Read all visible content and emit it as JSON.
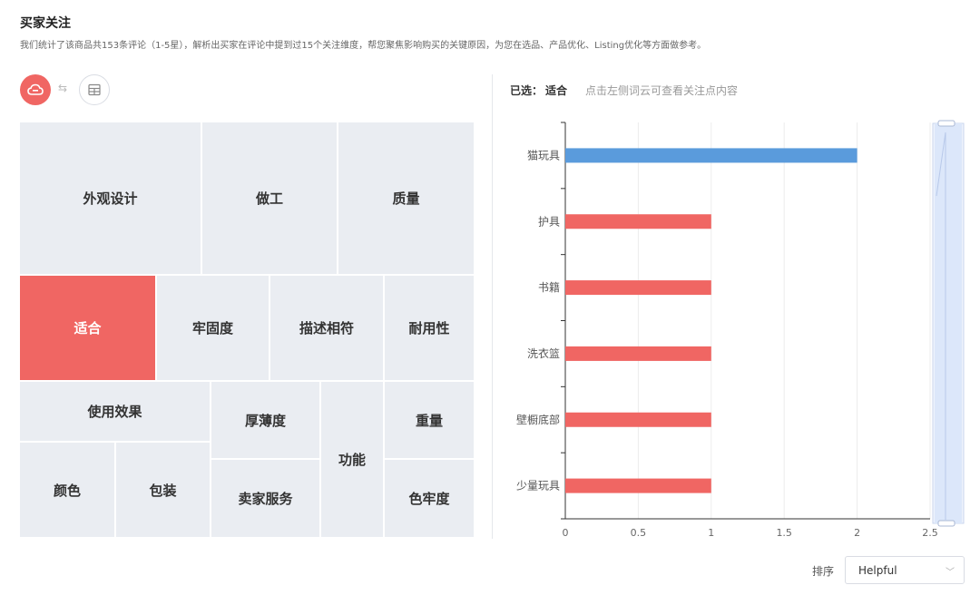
{
  "header": {
    "title": "买家关注",
    "description": "我们统计了该商品共153条评论（1-5星），解析出买家在评论中提到过15个关注维度，帮您聚焦影响购买的关键原因，为您在选品、产品优化、Listing优化等方面做参考。"
  },
  "view_toggle": {
    "active": "wordcloud",
    "icons": [
      "wordcloud-icon",
      "swap-icon",
      "table-icon"
    ],
    "swap_glyph": "⇆"
  },
  "treemap": {
    "selected": "适合",
    "tiles": [
      "外观设计",
      "做工",
      "质量",
      "适合",
      "牢固度",
      "描述相符",
      "耐用性",
      "使用效果",
      "厚薄度",
      "功能",
      "重量",
      "颜色",
      "包装",
      "卖家服务",
      "色牢度"
    ]
  },
  "detail": {
    "selected_label": "已选：",
    "selected_value": "适合",
    "hint": "点击左侧词云可查看关注点内容"
  },
  "chart_data": {
    "type": "bar",
    "orientation": "horizontal",
    "categories": [
      "猫玩具",
      "护具",
      "书籍",
      "洗衣篮",
      "壁橱底部",
      "少量玩具"
    ],
    "values": [
      2,
      1,
      1,
      1,
      1,
      1
    ],
    "highlighted": "猫玩具",
    "colors": {
      "highlight": "#5a9bdc",
      "default": "#f06663"
    },
    "xlim": [
      0,
      2.5
    ],
    "xticks": [
      "0",
      "0.5",
      "1",
      "1.5",
      "2",
      "2.5"
    ],
    "grid": true,
    "zoom_slider": {
      "start": 0,
      "end": 1
    }
  },
  "sort": {
    "label": "排序",
    "value": "Helpful",
    "chevron": "﹀"
  },
  "colors": {
    "accent": "#f06663",
    "tile": "#eaedf2",
    "bar_highlight": "#5a9bdc"
  }
}
